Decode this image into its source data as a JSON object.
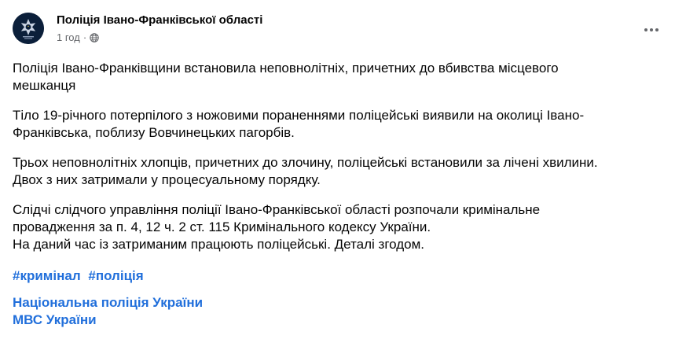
{
  "post": {
    "author": {
      "name": "Поліція Івано-Франківської області",
      "time": "1 год",
      "separator": "·",
      "privacy_icon": "globe-icon"
    },
    "menu_icon": "more-horizontal-icon",
    "paragraphs": [
      "Поліція Івано-Франківщини встановила неповнолітніх, причетних до вбивства місцевого\nмешканця",
      "Тіло 19-річного потерпілого з ножовими пораненнями поліцейські виявили на околиці Івано-\nФранківська, поблизу Вовчинецьких пагорбів.",
      "Трьох неповнолітніх хлопців, причетних до злочину, поліцейські встановили за лічені хвилини.\nДвох з них затримали у процесуальному порядку.",
      "Слідчі слідчого управління поліції Івано-Франківської області розпочали кримінальне\nпровадження за п. 4, 12 ч. 2 ст. 115 Кримінального кодексу України.\nНа даний час із затриманим працюють поліцейські. Деталі згодом."
    ],
    "hashtags": [
      "#кримінал",
      "#поліція"
    ],
    "mentions": [
      "Національна поліція України",
      "МВС України"
    ]
  },
  "colors": {
    "text": "#050505",
    "muted": "#65676b",
    "link": "#216fdb",
    "avatar_bg": "#0b1f3a"
  }
}
